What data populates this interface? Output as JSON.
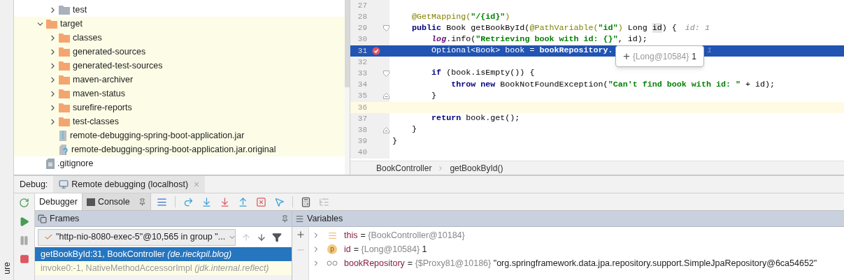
{
  "project_tree": {
    "partial_top": [
      {
        "label": "test",
        "kind": "test-folder",
        "expanded": false,
        "highlighted": false
      }
    ],
    "items": [
      {
        "label": "target",
        "kind": "excluded-folder",
        "expanded": true,
        "highlighted": true,
        "children": [
          {
            "label": "classes",
            "kind": "excluded-folder",
            "expanded": false,
            "highlighted": true
          },
          {
            "label": "generated-sources",
            "kind": "excluded-folder",
            "expanded": false,
            "highlighted": true
          },
          {
            "label": "generated-test-sources",
            "kind": "excluded-folder",
            "expanded": false,
            "highlighted": true
          },
          {
            "label": "maven-archiver",
            "kind": "excluded-folder",
            "expanded": false,
            "highlighted": true
          },
          {
            "label": "maven-status",
            "kind": "excluded-folder",
            "expanded": false,
            "highlighted": true
          },
          {
            "label": "surefire-reports",
            "kind": "excluded-folder",
            "expanded": false,
            "highlighted": true
          },
          {
            "label": "test-classes",
            "kind": "excluded-folder",
            "expanded": false,
            "highlighted": true
          },
          {
            "label": "remote-debugging-spring-boot-application.jar",
            "kind": "archive",
            "highlighted": true
          },
          {
            "label": "remote-debugging-spring-boot-application.jar.original",
            "kind": "unknown-file",
            "highlighted": true
          }
        ]
      },
      {
        "label": ".gitignore",
        "kind": "text-file",
        "highlighted": false
      }
    ]
  },
  "editor": {
    "lines": [
      {
        "number": "27",
        "kind": "plain",
        "selected": false,
        "current": false,
        "breakpoint": false
      },
      {
        "number": "28",
        "kind": "plain",
        "selected": false,
        "current": false,
        "breakpoint": false,
        "tokens": [
          {
            "text": "    @GetMapping(",
            "kind": "annotation"
          },
          {
            "text": "\"/{id}\"",
            "kind": "string"
          },
          {
            "text": ")",
            "kind": "annotation"
          }
        ]
      },
      {
        "number": "29",
        "kind": "fold-start",
        "selected": false,
        "current": false,
        "breakpoint": false,
        "tokens": [
          {
            "text": "    public",
            "kind": "keyword"
          },
          {
            "text": " Book getBookById(",
            "kind": "plain"
          },
          {
            "text": "@PathVariable(",
            "kind": "annotation"
          },
          {
            "text": "\"id\"",
            "kind": "string"
          },
          {
            "text": ")",
            "kind": "annotation"
          },
          {
            "text": " Long ",
            "kind": "plain"
          },
          {
            "text": "id",
            "kind": "usage"
          },
          {
            "text": ") {",
            "kind": "plain"
          },
          {
            "text": "id: 1",
            "kind": "hint"
          }
        ]
      },
      {
        "number": "30",
        "kind": "plain",
        "selected": false,
        "current": false,
        "breakpoint": false,
        "tokens": [
          {
            "text": "        log",
            "kind": "field"
          },
          {
            "text": ".info(",
            "kind": "plain"
          },
          {
            "text": "\"Retrieving book with id: {}\"",
            "kind": "string"
          },
          {
            "text": ", id);",
            "kind": "plain"
          }
        ]
      },
      {
        "number": "31",
        "kind": "plain",
        "selected": true,
        "current": false,
        "breakpoint": true,
        "tokens": [
          {
            "text": "        Optional<Book> book = ",
            "kind": "plain"
          },
          {
            "text": "bookRepository.",
            "kind": "bold"
          }
        ],
        "hint_after_popup": "1"
      },
      {
        "number": "32",
        "kind": "plain",
        "selected": false,
        "current": false,
        "breakpoint": false
      },
      {
        "number": "33",
        "kind": "fold-start",
        "selected": false,
        "current": false,
        "breakpoint": false,
        "tokens": [
          {
            "text": "        if",
            "kind": "keyword"
          },
          {
            "text": " (book.isEmpty()) {",
            "kind": "plain"
          }
        ]
      },
      {
        "number": "34",
        "kind": "plain",
        "selected": false,
        "current": false,
        "breakpoint": false,
        "tokens": [
          {
            "text": "            throw new",
            "kind": "keyword"
          },
          {
            "text": " BookNotFoundException(",
            "kind": "plain"
          },
          {
            "text": "\"Can't find book with id: \"",
            "kind": "string"
          },
          {
            "text": " + id);",
            "kind": "plain"
          }
        ]
      },
      {
        "number": "35",
        "kind": "fold-end",
        "selected": false,
        "current": false,
        "breakpoint": false,
        "tokens": [
          {
            "text": "        }",
            "kind": "plain"
          }
        ]
      },
      {
        "number": "36",
        "kind": "plain",
        "selected": false,
        "current": true,
        "breakpoint": false
      },
      {
        "number": "37",
        "kind": "plain",
        "selected": false,
        "current": false,
        "breakpoint": false,
        "tokens": [
          {
            "text": "        return",
            "kind": "keyword"
          },
          {
            "text": " book.get();",
            "kind": "plain"
          }
        ]
      },
      {
        "number": "38",
        "kind": "fold-end",
        "selected": false,
        "current": false,
        "breakpoint": false,
        "tokens": [
          {
            "text": "    }",
            "kind": "plain"
          }
        ]
      },
      {
        "number": "39",
        "kind": "plain",
        "selected": false,
        "current": false,
        "breakpoint": false,
        "tokens": [
          {
            "text": "}",
            "kind": "plain"
          }
        ]
      },
      {
        "number": "40",
        "kind": "plain",
        "selected": false,
        "current": false,
        "breakpoint": false
      }
    ],
    "popup": {
      "expand": "+",
      "type": "{Long@10584}",
      "value": "1"
    },
    "breadcrumbs": [
      "BookController",
      "getBookById()"
    ]
  },
  "debug": {
    "label": "Debug:",
    "session_tab": {
      "label": "Remote debugging (localhost)",
      "close": "×"
    },
    "tabs": [
      {
        "label": "Debugger",
        "selected": true
      },
      {
        "label": "Console",
        "selected": false
      }
    ],
    "frames": {
      "title": "Frames",
      "thread": "\"http-nio-8080-exec-5\"@10,565 in group \"...",
      "rows": [
        {
          "method": "getBookById:31, BookController",
          "package": "(de.rieckpil.blog)",
          "selected": true,
          "kind": "app"
        },
        {
          "method": "invoke0:-1, NativeMethodAccessorImpl",
          "package": "(jdk.internal.reflect)",
          "selected": false,
          "kind": "library"
        }
      ]
    },
    "variables": {
      "title": "Variables",
      "rows": [
        {
          "name": "this",
          "kind": "object",
          "equals": "=",
          "value": "{BookController@10184}"
        },
        {
          "name": "id",
          "kind": "parameter",
          "badge": "p",
          "equals": "=",
          "value": "{Long@10584}",
          "extra": "1"
        },
        {
          "name": "bookRepository",
          "kind": "watch",
          "equals": "=",
          "value": "{$Proxy81@10186}",
          "extra": "\"org.springframework.data.jpa.repository.support.SimpleJpaRepository@6ca54652\""
        }
      ]
    }
  },
  "side_label": "ure"
}
